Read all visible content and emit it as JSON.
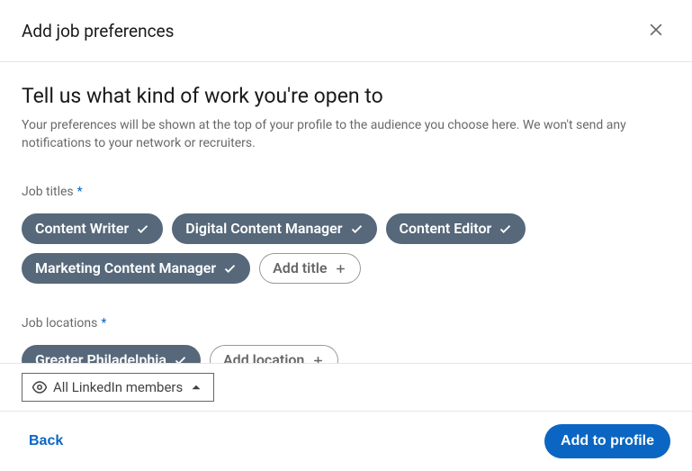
{
  "header": {
    "title": "Add job preferences"
  },
  "body": {
    "heading": "Tell us what kind of work you're open to",
    "subheading": "Your preferences will be shown at the top of your profile to the audience you choose here. We won't send any notifications to your network or recruiters.",
    "required_marker": "*",
    "job_titles": {
      "label": "Job titles",
      "items": [
        "Content Writer",
        "Digital Content Manager",
        "Content Editor",
        "Marketing Content Manager"
      ],
      "add_label": "Add title"
    },
    "job_locations": {
      "label": "Job locations",
      "items": [
        "Greater Philadelphia"
      ],
      "add_label": "Add location"
    }
  },
  "visibility": {
    "label": "All LinkedIn members"
  },
  "footer": {
    "back_label": "Back",
    "add_label": "Add to profile"
  }
}
